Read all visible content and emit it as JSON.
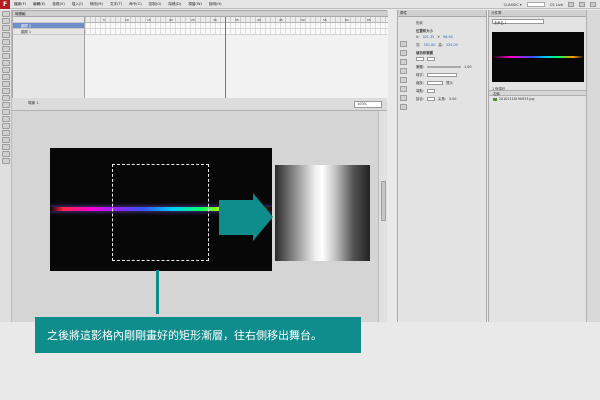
{
  "app": {
    "logo": "F",
    "menus": [
      "檔案(F)",
      "編輯(E)",
      "檢視(V)",
      "插入(I)",
      "修改(M)",
      "文字(T)",
      "命令(C)",
      "控制(O)",
      "除錯(D)",
      "視窗(W)",
      "說明(H)"
    ],
    "workspace": "CLASSIC ▾",
    "cs_live": "CS Live"
  },
  "timeline": {
    "tab_label": "時間軸",
    "layers": [
      {
        "name": "圖層 2",
        "selected": true
      },
      {
        "name": "圖層 1",
        "selected": false
      }
    ],
    "ruler_numbers": [
      "5",
      "10",
      "15",
      "20",
      "25",
      "30",
      "35",
      "40",
      "45",
      "50",
      "55",
      "60",
      "65"
    ]
  },
  "stage": {
    "scene_label": "場景 1",
    "zoom": "100%"
  },
  "caption": {
    "text": "之後將這影格內剛剛畫好的矩形漸層，往右側移出舞台。"
  },
  "properties": {
    "tab_label": "屬性",
    "type_label": "形狀",
    "position_header": "位置和大小",
    "x_label": "X:",
    "x_value": "321.35",
    "y_label": "Y:",
    "y_value": "98.85",
    "w_label": "寬:",
    "w_value": "301.00",
    "h_label": "高:",
    "h_value": "229.00",
    "fill_header": "填色和筆觸",
    "stroke_label": "筆觸:",
    "stroke_value": "1.00",
    "style_label": "樣式:",
    "scale_label": "縮放:",
    "hint_label": "提示",
    "cap_label": "端點:",
    "join_label": "接合:",
    "miter_label": "尖角:",
    "miter_value": "3.00"
  },
  "library": {
    "tab_label": "元件庫",
    "doc_select": "未命名-1",
    "item_count": "1 個項目",
    "col_header": "名稱",
    "items": [
      "20101118190933.jpg"
    ]
  },
  "colors": {
    "accent": "#0f8c8c",
    "playhead": "#e34848",
    "layer_selected": "#6f8fc9"
  }
}
